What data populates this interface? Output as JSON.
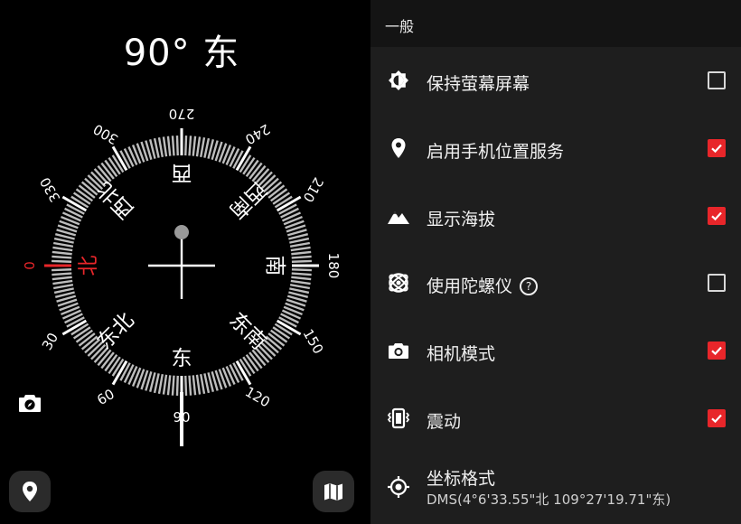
{
  "compass": {
    "heading": "90° 东",
    "degree_labels": [
      "0",
      "30",
      "60",
      "90",
      "120",
      "150",
      "180",
      "210",
      "240",
      "270",
      "300",
      "330"
    ],
    "directions": {
      "north": "北",
      "northeast": "东北",
      "east": "东",
      "southeast": "东南",
      "south": "南",
      "southwest": "西南",
      "west": "西",
      "northwest": "西北"
    },
    "accent_color": "#e8262a"
  },
  "settings": {
    "section_title": "一般",
    "items": [
      {
        "label": "保持萤幕屏幕",
        "checked": false,
        "icon": "brightness-icon"
      },
      {
        "label": "启用手机位置服务",
        "checked": true,
        "icon": "location-pin-icon"
      },
      {
        "label": "显示海拔",
        "checked": true,
        "icon": "mountain-icon"
      },
      {
        "label": "使用陀螺仪",
        "checked": false,
        "icon": "gyroscope-icon",
        "help": "?"
      },
      {
        "label": "相机模式",
        "checked": true,
        "icon": "camera-icon"
      },
      {
        "label": "震动",
        "checked": true,
        "icon": "vibrate-icon"
      }
    ],
    "coordinate_format": {
      "label": "坐标格式",
      "value": "DMS(4°6'33.55\"北  109°27'19.71\"东)",
      "icon": "crosshair-icon"
    },
    "checkbox_color": "#e8262a"
  }
}
